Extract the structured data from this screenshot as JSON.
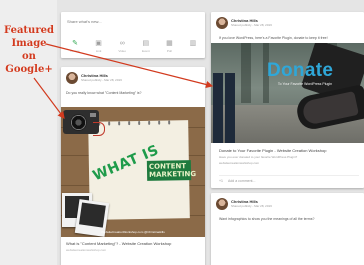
{
  "annotation": {
    "label": "Featured Image on Google+",
    "color": "#d23a1e"
  },
  "share": {
    "placeholder": "Share what's new...",
    "actions": [
      {
        "label": "Photos",
        "icon": "pencil-icon"
      },
      {
        "label": "Link",
        "icon": "camera-icon"
      },
      {
        "label": "Video",
        "icon": "link-icon"
      },
      {
        "label": "Event",
        "icon": "video-icon"
      },
      {
        "label": "Poll",
        "icon": "event-icon"
      },
      {
        "label": "",
        "icon": "poll-icon"
      }
    ]
  },
  "left_post": {
    "author": "Christina Hills",
    "time": "Shared publicly - Mar 28, 2016",
    "body": "Do you really know what \"Content Marketing\" is?",
    "image": {
      "headline_part1": "WHAT IS",
      "headline_part2": "CONTENT MARKETING",
      "caption": "WebsiteCreationWorkshop.com  @ChristinaHills"
    },
    "link_title": "What is \"Content Marketing\"? - Website Creation Workshop",
    "link_domain": "websitecreationworkshop.com"
  },
  "right_post": {
    "author": "Christina Hills",
    "time": "Shared publicly - Mar 28, 2016",
    "body": "If you love WordPress, here's a Favorite Plugin, donate to keep it free!",
    "image": {
      "headline": "Donate",
      "subline": "To Your Favorite WordPress Plugin"
    },
    "link_title": "Donate to Your Favorite Plugin - Website Creation Workshop",
    "link_desc": "Have you ever donated to your favorite WordPress Plugin?",
    "link_domain": "websitecreationworkshop.com",
    "actions": {
      "plus": "+1",
      "share": "Add a comment..."
    }
  },
  "right_post_2": {
    "author": "Christina Hills",
    "time": "Shared publicly - Mar 28, 2016",
    "body": "Want infographics to show you the meanings of all the terms?"
  }
}
